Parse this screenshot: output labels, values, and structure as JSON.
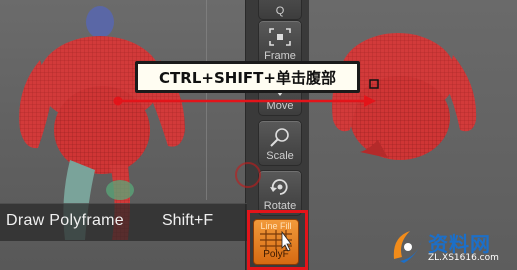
{
  "callout": {
    "text": "CTRL+SHIFT+单击腹部"
  },
  "tooltip": {
    "name": "Draw Polyframe",
    "shortcut": "Shift+F"
  },
  "toolbar": {
    "items": [
      {
        "label": "Frame"
      },
      {
        "label": "Move"
      },
      {
        "label": "Scale"
      },
      {
        "label": "Rotate"
      }
    ],
    "polyf": {
      "label": "PolyF",
      "ghost_label": "Line Fill"
    }
  },
  "watermark": {
    "brand": "资料网",
    "url": "ZL.XS1616.com"
  },
  "colors": {
    "accent": "#e3141a",
    "polyf": "#e8821f",
    "brand": "#1c6fc8"
  }
}
